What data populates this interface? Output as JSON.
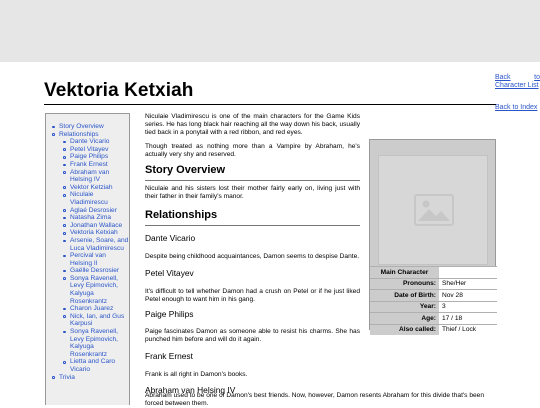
{
  "nav": {
    "back_prefix": "Back",
    "back_to": "to",
    "back_charlist": "Character List",
    "back_index": "Back to Index"
  },
  "page": {
    "title": "Vektoria Ketxiah"
  },
  "sidebar": {
    "items": [
      {
        "label": "Story Overview",
        "level": 1
      },
      {
        "label": "Relationships",
        "level": 1
      },
      {
        "label": "Dante Vicario",
        "level": 2
      },
      {
        "label": "Petel Vitayev",
        "level": 2
      },
      {
        "label": "Paige Philips",
        "level": 2
      },
      {
        "label": "Frank Ernest",
        "level": 2
      },
      {
        "label": "Abraham van Helsing IV",
        "level": 2
      },
      {
        "label": "Vektor Ketziah",
        "level": 2
      },
      {
        "label": "Niculaie Vladimirescu",
        "level": 2
      },
      {
        "label": "Aglaé Desrosier",
        "level": 2
      },
      {
        "label": "Natasha Zima",
        "level": 2
      },
      {
        "label": "Jonathan Wallace",
        "level": 2
      },
      {
        "label": "Vektoria Ketxiah",
        "level": 2
      },
      {
        "label": "Arsenie, Soare, and Luca Vladimirescu",
        "level": 2
      },
      {
        "label": "Percival van Helsing II",
        "level": 2
      },
      {
        "label": "Gaëlle Desrosier",
        "level": 2
      },
      {
        "label": "Sonya Ravenell, Levy Epimovich, Kalyuga Rosenkrantz",
        "level": 2
      },
      {
        "label": "Charon Juarez",
        "level": 2
      },
      {
        "label": "Nick, Ian, and Gus Karpusi",
        "level": 2
      },
      {
        "label": "Sonya Ravenell, Levy Epimovich, Kalyuga Rosenkrantz",
        "level": 2
      },
      {
        "label": "Lietta and Caro Vicario",
        "level": 2
      },
      {
        "label": "Trivia",
        "level": 1
      }
    ]
  },
  "content": {
    "intro_1": "Niculaie Vladimirescu is one of the main characters for the Game Kids series. He has long black hair reaching all the way down his back, usually tied back in a ponytail with a red ribbon, and red eyes.",
    "intro_2": "Though treated as nothing more than a Vampire by Abraham, he's actually very shy and reserved.",
    "story_heading": "Story Overview",
    "story_text": "Niculaie and his sisters lost their mother fairly early on, living just with their father in their family's manor.",
    "relationships_heading": "Relationships",
    "relationships": [
      {
        "name": "Dante Vicario",
        "text": "Despite being childhood acquaintances, Damon seems to despise Dante."
      },
      {
        "name": "Petel Vitayev",
        "text": "It's difficult to tell whether Damon had a crush on Petel or if he just liked Petel enough to want him in his gang."
      },
      {
        "name": "Paige Philips",
        "text": "Paige fascinates Damon as someone able to resist his charms. She has punched him before and will do it again."
      },
      {
        "name": "Frank Ernest",
        "text": "Frank is all right in Damon's books."
      },
      {
        "name": "Abraham van Helsing IV",
        "text": "Abraham used to be one of Damon's best friends. Now, however, Damon resents Abraham for this divide that's been forced between them."
      }
    ]
  },
  "infobox": {
    "image_icon": "image-placeholder-icon",
    "header_label": "Main Character",
    "rows": [
      {
        "label": "Pronouns:",
        "value": "She/Her"
      },
      {
        "label": "Date of Birth:",
        "value": "Nov 28"
      },
      {
        "label": "Year:",
        "value": "3"
      },
      {
        "label": "Age:",
        "value": "17 / 18"
      },
      {
        "label": "Also called:",
        "value": "Thief / Lock"
      }
    ]
  },
  "colors": {
    "link": "#2a55c9",
    "topbar": "#e6e6e6",
    "sidebar_bg": "#eeeeee",
    "infobox_bg": "#cccccc"
  }
}
